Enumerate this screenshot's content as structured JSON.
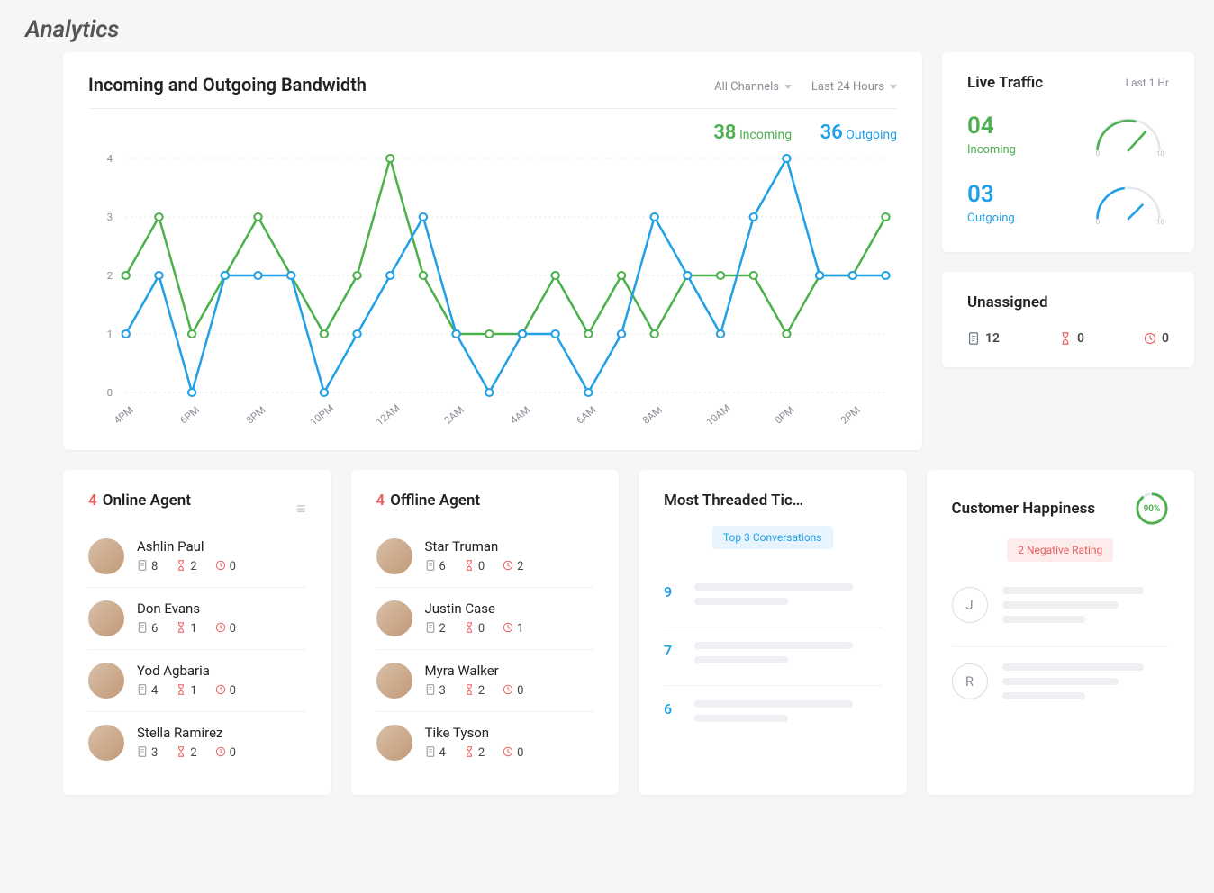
{
  "brand": "Analytics",
  "bandwidth": {
    "title": "Incoming and Outgoing Bandwidth",
    "filter_channel": "All Channels",
    "filter_time": "Last 24 Hours",
    "legend": {
      "incoming_value": "38",
      "incoming_label": "Incoming",
      "outgoing_value": "36",
      "outgoing_label": "Outgoing"
    }
  },
  "chart_data": {
    "type": "line",
    "xlabel": "",
    "ylabel": "",
    "ylim": [
      0,
      4
    ],
    "x": [
      "4PM",
      "6PM",
      "8PM",
      "10PM",
      "12AM",
      "2AM",
      "4AM",
      "6AM",
      "8AM",
      "10AM",
      "0PM",
      "2PM"
    ],
    "series": [
      {
        "name": "Incoming",
        "color": "#4cb04c",
        "values": [
          2,
          3,
          1,
          2,
          3,
          2,
          1,
          2,
          4,
          2,
          1,
          1,
          1,
          2,
          1,
          2,
          1,
          2,
          2,
          2,
          1,
          2,
          2,
          3
        ]
      },
      {
        "name": "Outgoing",
        "color": "#22a0e6",
        "values": [
          1,
          2,
          0,
          2,
          2,
          2,
          0,
          1,
          2,
          3,
          1,
          0,
          1,
          1,
          0,
          1,
          3,
          2,
          1,
          3,
          4,
          2,
          2,
          2
        ]
      }
    ]
  },
  "live": {
    "title": "Live Traffic",
    "period": "Last 1 Hr",
    "incoming_value": "04",
    "incoming_label": "Incoming",
    "outgoing_value": "03",
    "outgoing_label": "Outgoing",
    "gauge_min": "0",
    "gauge_max": "10"
  },
  "unassigned": {
    "title": "Unassigned",
    "docs": "12",
    "hourglass": "0",
    "clock": "0"
  },
  "online_agents": {
    "count": "4",
    "label": "Online Agent",
    "items": [
      {
        "name": "Ashlin Paul",
        "docs": "8",
        "hour": "2",
        "clock": "0"
      },
      {
        "name": "Don Evans",
        "docs": "6",
        "hour": "1",
        "clock": "0"
      },
      {
        "name": "Yod Agbaria",
        "docs": "4",
        "hour": "1",
        "clock": "0"
      },
      {
        "name": "Stella Ramirez",
        "docs": "3",
        "hour": "2",
        "clock": "0"
      }
    ]
  },
  "offline_agents": {
    "count": "4",
    "label": "Offline Agent",
    "items": [
      {
        "name": "Star Truman",
        "docs": "6",
        "hour": "0",
        "clock": "2"
      },
      {
        "name": "Justin Case",
        "docs": "2",
        "hour": "0",
        "clock": "1"
      },
      {
        "name": "Myra Walker",
        "docs": "3",
        "hour": "2",
        "clock": "0"
      },
      {
        "name": "Tike Tyson",
        "docs": "4",
        "hour": "2",
        "clock": "0"
      }
    ]
  },
  "threaded": {
    "title": "Most Threaded Tic…",
    "pill": "Top 3 Conversations",
    "nums": [
      "9",
      "7",
      "6"
    ]
  },
  "happiness": {
    "title": "Customer Happiness",
    "ring": "90%",
    "pill": "2  Negative Rating",
    "initials": [
      "J",
      "R"
    ]
  }
}
